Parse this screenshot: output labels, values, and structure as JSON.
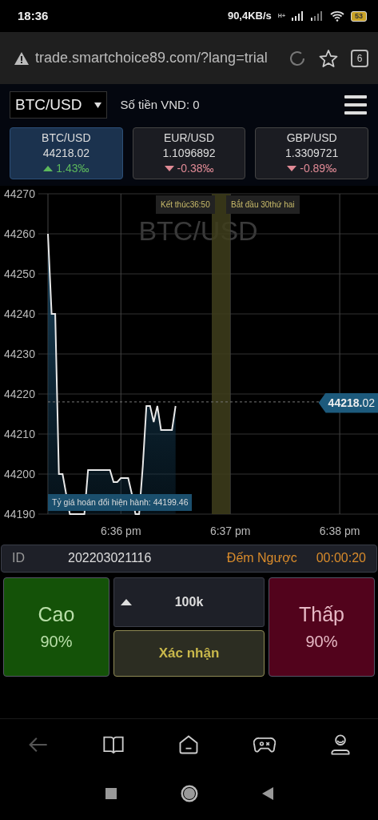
{
  "status_bar": {
    "time": "18:36",
    "speed": "90,4KB/s",
    "network": "H+",
    "battery": "53"
  },
  "browser": {
    "url": "trade.smartchoice89.com/?lang=trial",
    "tab_count": "6"
  },
  "header": {
    "pair_select": "BTC/USD",
    "balance_label": "Số tiền VND:",
    "balance": "0"
  },
  "pairs": [
    {
      "name": "BTC/USD",
      "price": "44218.02",
      "change": "1.43‰",
      "kind": "up",
      "selected": true
    },
    {
      "name": "EUR/USD",
      "price": "1.1096892",
      "change": "-0.38‰",
      "kind": "down",
      "selected": false
    },
    {
      "name": "GBP/USD",
      "price": "1.3309721",
      "change": "-0.89‰",
      "kind": "down",
      "selected": false
    }
  ],
  "chart": {
    "watermark": "BTC/USD",
    "markers": [
      {
        "kind": "end",
        "label": "Kết thúc36:50"
      },
      {
        "kind": "start",
        "label": "Bắt đầu 30thứ hai"
      }
    ],
    "rate_label": "Tỷ giá hoán đổi hiện hành: 44199.46",
    "chart_data": {
      "type": "area",
      "grid": true,
      "ref_lines": [
        {
          "axis": "y",
          "value": 44218.02,
          "label": "44218.02"
        }
      ],
      "ylim": [
        44190,
        44270
      ],
      "yticks": [
        44190,
        44200,
        44210,
        44220,
        44230,
        44240,
        44250,
        44260,
        44270
      ],
      "categories": [
        null,
        null,
        null,
        null,
        null,
        null,
        null,
        null,
        null,
        null,
        null,
        null,
        null,
        null,
        null,
        null,
        null,
        null,
        null,
        null,
        "6:36 pm",
        null,
        null,
        null,
        null,
        null,
        null,
        null,
        null,
        null,
        null,
        null,
        null,
        null,
        null,
        null,
        null,
        null,
        null,
        null,
        null,
        null,
        null,
        null,
        null,
        null,
        null,
        null,
        null,
        null,
        "6:37 pm",
        null,
        null,
        null,
        null,
        null,
        null,
        null,
        null,
        null,
        null,
        null,
        null,
        null,
        null,
        null,
        null,
        null,
        null,
        null,
        null,
        null,
        null,
        null,
        null,
        null,
        null,
        null,
        null,
        null,
        "6:38 pm",
        null,
        null,
        null,
        null,
        null,
        null,
        null,
        null,
        null,
        null
      ],
      "values": [
        44260,
        44240,
        44240,
        44200,
        44200,
        44195,
        44190,
        44190,
        44190,
        44190,
        44190,
        44201,
        44201,
        44201,
        44201,
        44201,
        44201,
        44201,
        44198,
        44198,
        44199,
        44199,
        44199,
        44195,
        44190,
        44190,
        44202,
        44217,
        44217,
        44213,
        44217,
        44211,
        44211,
        44211,
        44211,
        44217,
        null,
        null,
        null,
        null,
        null,
        null,
        null,
        null,
        null,
        null,
        null,
        null,
        null,
        null,
        null,
        null,
        null,
        null,
        null,
        null,
        null,
        null,
        null,
        null,
        null,
        null,
        null,
        null,
        null,
        null,
        null,
        null,
        null,
        null,
        null,
        null,
        null,
        null,
        null,
        null,
        null,
        null,
        null,
        null,
        null,
        null,
        null,
        null,
        null,
        null,
        null,
        null,
        null,
        null,
        null
      ]
    }
  },
  "order_bar": {
    "id_label": "ID",
    "id": "202203021116",
    "countdown_label": "Đếm Ngược",
    "countdown": "00:00:20"
  },
  "trade": {
    "up": {
      "label": "Cao",
      "payout": "90%"
    },
    "amount": "100k",
    "confirm": "Xác nhận",
    "down": {
      "label": "Thấp",
      "payout": "90%"
    }
  },
  "bottom_nav": [
    {
      "kind": "back",
      "disabled": true
    },
    {
      "kind": "book",
      "disabled": false
    },
    {
      "kind": "home",
      "disabled": false
    },
    {
      "kind": "game",
      "disabled": false
    },
    {
      "kind": "profile",
      "disabled": false
    }
  ]
}
